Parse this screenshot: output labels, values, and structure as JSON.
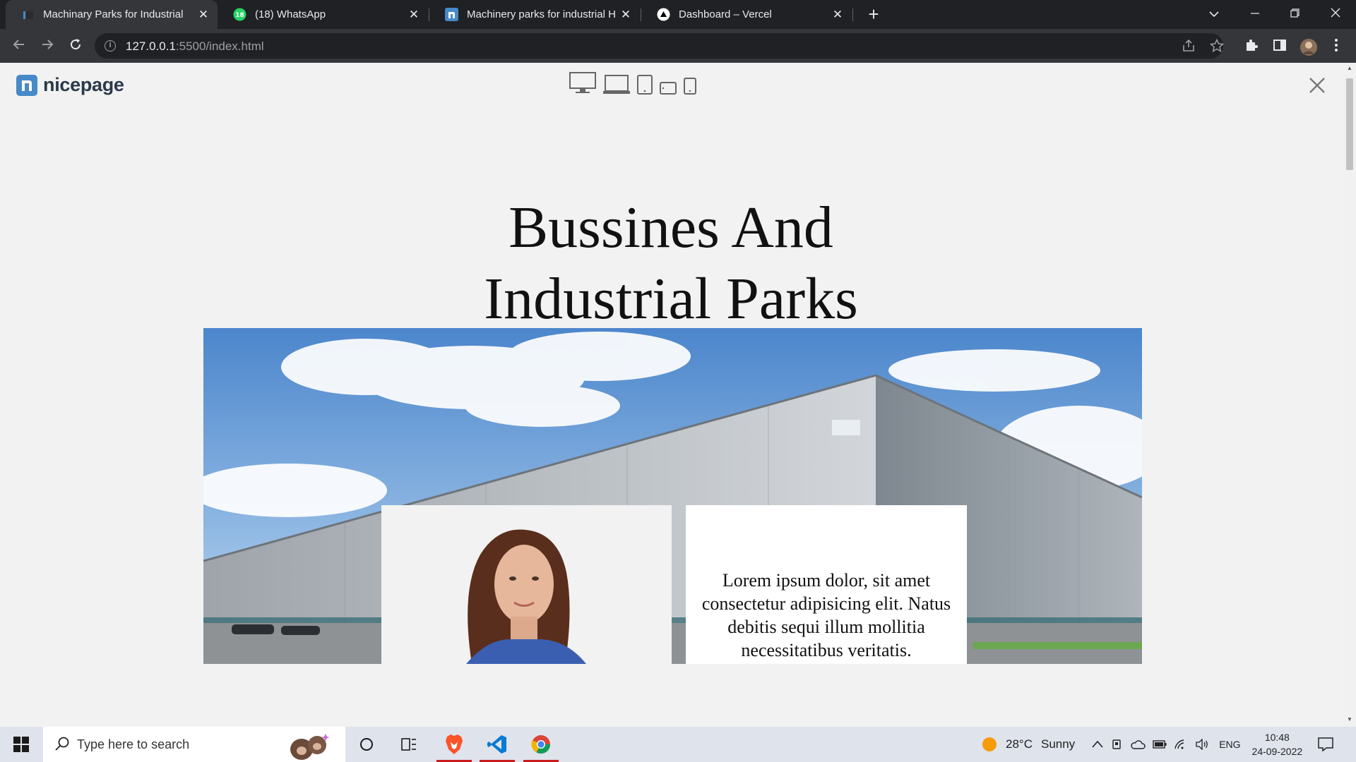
{
  "browser": {
    "tabs": [
      {
        "title": "Machinary Parks for Industrial",
        "favicon": "nicepage-icon",
        "active": true
      },
      {
        "title": "(18) WhatsApp",
        "favicon": "whatsapp-icon",
        "badge": "18",
        "active": false
      },
      {
        "title": "Machinery parks for industrial HTML",
        "favicon": "nicepage-icon",
        "active": false
      },
      {
        "title": "Dashboard – Vercel",
        "favicon": "vercel-icon",
        "active": false
      }
    ],
    "url_host": "127.0.0.1",
    "url_rest": ":5500/index.html"
  },
  "page": {
    "logo_text": "nicepage",
    "devices": [
      "desktop-icon",
      "laptop-icon",
      "tablet-icon",
      "tablet-landscape-icon",
      "phone-icon"
    ],
    "hero_title_line1": "Bussines And",
    "hero_title_line2": "Industrial Parks",
    "card_text": "Lorem ipsum dolor, sit amet consectetur adipisicing elit. Natus debitis sequi illum mollitia necessitatibus veritatis."
  },
  "taskbar": {
    "search_placeholder": "Type here to search",
    "weather_temp": "28°C",
    "weather_desc": "Sunny",
    "language": "ENG",
    "time": "10:48",
    "date": "24-09-2022"
  },
  "colors": {
    "brand_blue": "#478ac9",
    "chrome_dark": "#202124",
    "page_bg": "#f2f2f2"
  }
}
